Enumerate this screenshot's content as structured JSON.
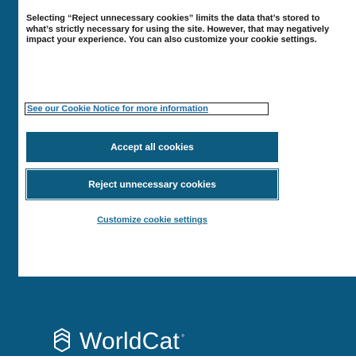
{
  "cookie_banner": {
    "description": "Selecting “Reject unnecessary cookies” limits the data that’s stored to what’s strictly necessary for using the site. However, that may negatively impact your experience. You can also customize your cookie settings.",
    "policy_link": "See our Cookie Notice for more information",
    "accept_label": "Accept all cookies",
    "reject_label": "Reject unnecessary cookies",
    "customize_label": "Customize cookie settings"
  },
  "brand": {
    "name": "WorldCat",
    "trademark": "°",
    "colors": {
      "primary": "#0a5780",
      "button": "#0d5b7e",
      "link": "#1d6b91"
    }
  }
}
